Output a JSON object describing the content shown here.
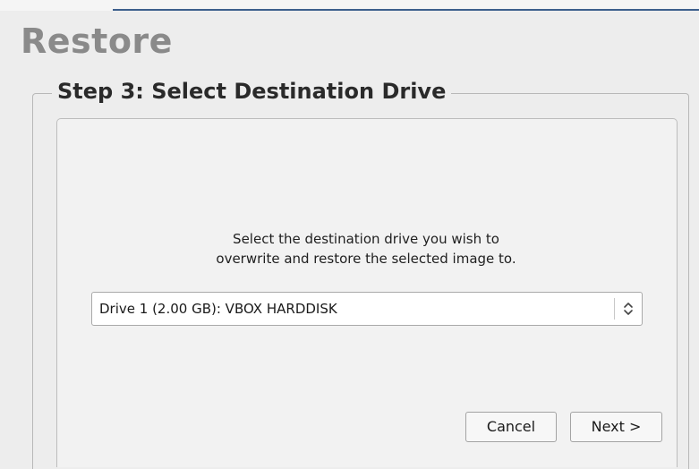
{
  "header": {
    "title": "Restore"
  },
  "step": {
    "legend": "Step 3: Select Destination Drive",
    "instructions_line1": "Select the destination drive you wish to",
    "instructions_line2": "overwrite and restore the selected image to."
  },
  "drive_select": {
    "selected_value": "Drive 1 (2.00 GB): VBOX HARDDISK",
    "icon": "chevron-up-down-icon"
  },
  "buttons": {
    "cancel_label": "Cancel",
    "next_label": "Next >"
  },
  "colors": {
    "title": "#8a8a8a",
    "background": "#ededed",
    "accent_line": "#3c5f8c"
  }
}
